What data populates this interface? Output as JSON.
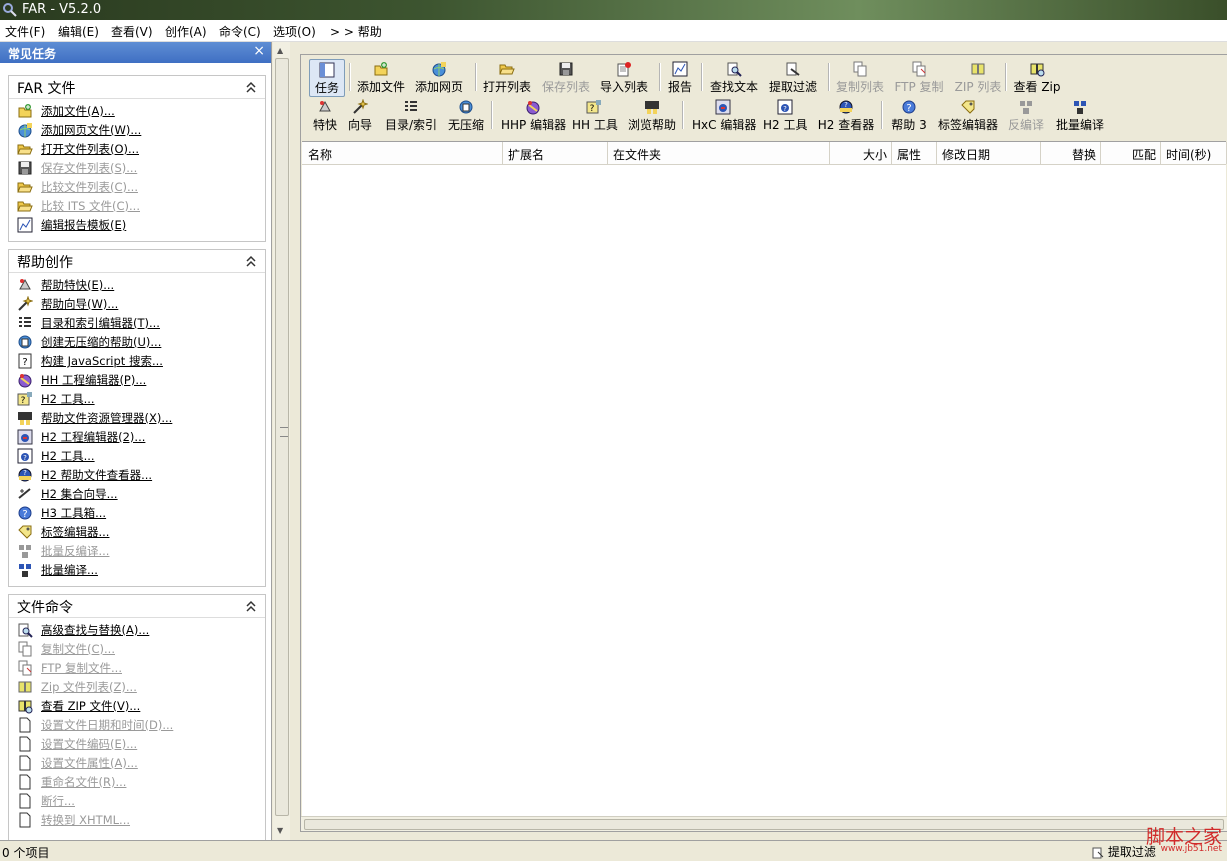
{
  "window": {
    "title": "FAR - V5.2.0"
  },
  "menu": [
    "文件(F)",
    "编辑(E)",
    "查看(V)",
    "创作(A)",
    "命令(C)",
    "选项(O)",
    "> > 帮助"
  ],
  "task_pane": {
    "title": "常见任务",
    "groups": [
      {
        "title": "FAR 文件",
        "items": [
          {
            "label": "添加文件(A)...",
            "icon": "add-file-icon",
            "enabled": true
          },
          {
            "label": "添加网页文件(W)...",
            "icon": "add-web-icon",
            "enabled": true
          },
          {
            "label": "打开文件列表(O)...",
            "icon": "open-folder-icon",
            "enabled": true
          },
          {
            "label": "保存文件列表(S)...",
            "icon": "save-icon",
            "enabled": false
          },
          {
            "label": "比较文件列表(C)...",
            "icon": "open-folder-icon",
            "enabled": false
          },
          {
            "label": "比较 ITS 文件(C)...",
            "icon": "open-folder-icon",
            "enabled": false
          },
          {
            "label": "编辑报告模板(E)",
            "icon": "report-icon",
            "enabled": true
          }
        ]
      },
      {
        "title": "帮助创作",
        "items": [
          {
            "label": "帮助特快(E)...",
            "icon": "express-icon",
            "enabled": true
          },
          {
            "label": "帮助向导(W)...",
            "icon": "wizard-icon",
            "enabled": true
          },
          {
            "label": "目录和索引编辑器(T)...",
            "icon": "toc-icon",
            "enabled": true
          },
          {
            "label": "创建无压缩的帮助(U)...",
            "icon": "uncompressed-icon",
            "enabled": true
          },
          {
            "label": "构建 JavaScript 搜索...",
            "icon": "question-doc-icon",
            "enabled": true
          },
          {
            "label": "HH 工程编辑器(P)...",
            "icon": "hhp-editor-icon",
            "enabled": true
          },
          {
            "label": "H2 工具...",
            "icon": "h2-tools-icon",
            "enabled": true
          },
          {
            "label": "帮助文件资源管理器(X)...",
            "icon": "help-explorer-icon",
            "enabled": true
          },
          {
            "label": "H2 工程编辑器(2)...",
            "icon": "h2-project-icon",
            "enabled": true
          },
          {
            "label": "H2 工具...",
            "icon": "h2-tools2-icon",
            "enabled": true
          },
          {
            "label": "H2 帮助文件查看器...",
            "icon": "h2-viewer-icon",
            "enabled": true
          },
          {
            "label": "H2 集合向导...",
            "icon": "h2-wizard-icon",
            "enabled": true
          },
          {
            "label": "H3 工具箱...",
            "icon": "help-circle-icon",
            "enabled": true
          },
          {
            "label": "标签编辑器...",
            "icon": "tag-icon",
            "enabled": true
          },
          {
            "label": "批量反编译...",
            "icon": "batch-decompile-icon",
            "enabled": false
          },
          {
            "label": "批量编译...",
            "icon": "batch-compile-icon",
            "enabled": true
          }
        ]
      },
      {
        "title": "文件命令",
        "items": [
          {
            "label": "高级查找与替换(A)...",
            "icon": "find-icon",
            "enabled": true
          },
          {
            "label": "复制文件(C)...",
            "icon": "copy-files-icon",
            "enabled": false
          },
          {
            "label": "FTP 复制文件...",
            "icon": "ftp-copy-icon",
            "enabled": false
          },
          {
            "label": "Zip 文件列表(Z)...",
            "icon": "zip-list-icon",
            "enabled": false
          },
          {
            "label": "查看 ZIP 文件(V)...",
            "icon": "view-zip-icon",
            "enabled": true
          },
          {
            "label": "设置文件日期和时间(D)...",
            "icon": "blank-doc-icon",
            "enabled": false
          },
          {
            "label": "设置文件编码(E)...",
            "icon": "blank-doc-icon",
            "enabled": false
          },
          {
            "label": "设置文件属性(A)...",
            "icon": "blank-doc-icon",
            "enabled": false
          },
          {
            "label": "重命名文件(R)...",
            "icon": "blank-doc-icon",
            "enabled": false
          },
          {
            "label": "断行...",
            "icon": "blank-doc-icon",
            "enabled": false
          },
          {
            "label": "转换到 XHTML...",
            "icon": "blank-doc-icon",
            "enabled": false
          }
        ]
      }
    ]
  },
  "toolbar1": [
    {
      "label": "任务",
      "icon": "tasks-icon",
      "enabled": true,
      "pressed": true
    },
    {
      "label": "添加文件",
      "icon": "add-file-icon",
      "enabled": true
    },
    {
      "label": "添加网页",
      "icon": "add-web-icon",
      "enabled": true
    },
    {
      "label": "打开列表",
      "icon": "open-folder-icon",
      "enabled": true
    },
    {
      "label": "保存列表",
      "icon": "save-icon",
      "enabled": false
    },
    {
      "label": "导入列表",
      "icon": "import-icon",
      "enabled": true
    },
    {
      "label": "报告",
      "icon": "report-icon",
      "enabled": true
    },
    {
      "label": "查找文本",
      "icon": "find-icon",
      "enabled": true
    },
    {
      "label": "提取过滤",
      "icon": "extract-icon",
      "enabled": true
    },
    {
      "label": "复制列表",
      "icon": "copy-files-icon",
      "enabled": false
    },
    {
      "label": "FTP 复制",
      "icon": "ftp-copy-icon",
      "enabled": false
    },
    {
      "label": "ZIP 列表",
      "icon": "zip-list-icon",
      "enabled": false
    },
    {
      "label": "查看 Zip",
      "icon": "view-zip-icon",
      "enabled": true
    }
  ],
  "toolbar2": [
    {
      "label": "特快",
      "icon": "express-icon",
      "enabled": true
    },
    {
      "label": "向导",
      "icon": "wizard-icon",
      "enabled": true
    },
    {
      "label": "目录/索引",
      "icon": "toc-icon",
      "enabled": true
    },
    {
      "label": "无压缩",
      "icon": "uncompressed-icon",
      "enabled": true
    },
    {
      "label": "HHP 编辑器",
      "icon": "hhp-editor-icon",
      "enabled": true
    },
    {
      "label": "HH 工具",
      "icon": "h2-tools-icon",
      "enabled": true
    },
    {
      "label": "浏览帮助",
      "icon": "help-explorer-icon",
      "enabled": true
    },
    {
      "label": "HxC 编辑器",
      "icon": "h2-project-icon",
      "enabled": true
    },
    {
      "label": "H2 工具",
      "icon": "h2-tools2-icon",
      "enabled": true
    },
    {
      "label": "H2 查看器",
      "icon": "h2-viewer-icon",
      "enabled": true
    },
    {
      "label": "帮助 3",
      "icon": "help-circle-icon",
      "enabled": true
    },
    {
      "label": "标签编辑器",
      "icon": "tag-icon",
      "enabled": true
    },
    {
      "label": "反编译",
      "icon": "batch-decompile-icon",
      "enabled": false
    },
    {
      "label": "批量编译",
      "icon": "batch-compile-icon",
      "enabled": true
    }
  ],
  "columns": [
    "名称",
    "扩展名",
    "在文件夹",
    "大小",
    "属性",
    "修改日期",
    "替换",
    "匹配",
    "时间(秒)"
  ],
  "status": {
    "items": "0 个项目",
    "right": "提取过滤"
  },
  "watermark": {
    "line1": "脚本之家",
    "line2": "www.jb51.net"
  }
}
